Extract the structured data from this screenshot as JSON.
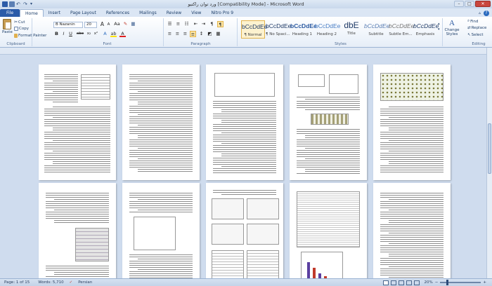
{
  "window": {
    "title": "ورد توان راکتیو [Compatibility Mode] - Microsoft Word",
    "controls": [
      "–",
      "□",
      "✕"
    ]
  },
  "quick_access": [
    "save-icon",
    "undo-icon",
    "redo-icon",
    "customize-icon"
  ],
  "tabs": [
    "File",
    "Home",
    "Insert",
    "Page Layout",
    "References",
    "Mailings",
    "Review",
    "View",
    "Nitro Pro 9"
  ],
  "active_tab": "Home",
  "clipboard": {
    "paste": "Paste",
    "cut": "Cut",
    "copy": "Copy",
    "format_painter": "Format Painter",
    "label": "Clipboard"
  },
  "font": {
    "name": "B Nazanin",
    "size": "20",
    "grow": "A",
    "shrink": "A",
    "case": "Aa",
    "bold": "B",
    "italic": "I",
    "underline": "U",
    "strike": "abe",
    "sub": "x₂",
    "sup": "x²",
    "color": "A",
    "label": "Font"
  },
  "paragraph": {
    "label": "Paragraph",
    "pilcrow": "¶"
  },
  "styles": {
    "items": [
      {
        "sample": "bCcDdEe",
        "name": "¶ Normal",
        "selected": true
      },
      {
        "sample": "bCcDdEe",
        "name": "¶ No Spaci..."
      },
      {
        "sample": "bCcDdEe",
        "name": "Heading 1"
      },
      {
        "sample": "bCcDdEe",
        "name": "Heading 2"
      },
      {
        "sample": "dbE",
        "name": "Title"
      },
      {
        "sample": "bCcDdEe",
        "name": "Subtitle"
      },
      {
        "sample": "bCcDdEe",
        "name": "Subtle Em..."
      },
      {
        "sample": "bCcDdEe",
        "name": "Emphasis"
      }
    ],
    "change": "Change Styles",
    "label": "Styles"
  },
  "editing": {
    "find": "Find",
    "replace": "Replace",
    "select": "Select",
    "label": "Editing"
  },
  "status": {
    "page": "Page: 1 of 15",
    "words": "Words: 5,710",
    "language": "Persian",
    "zoom": "20%",
    "zoom_minus": "−",
    "zoom_plus": "+",
    "zoom_fraction": 0.2
  },
  "colors": {
    "file_tab": "#2b5ba8",
    "ribbon_bg": "#e6eef8",
    "canvas_bg": "#cfdcee",
    "close_button": "#c9463d"
  }
}
